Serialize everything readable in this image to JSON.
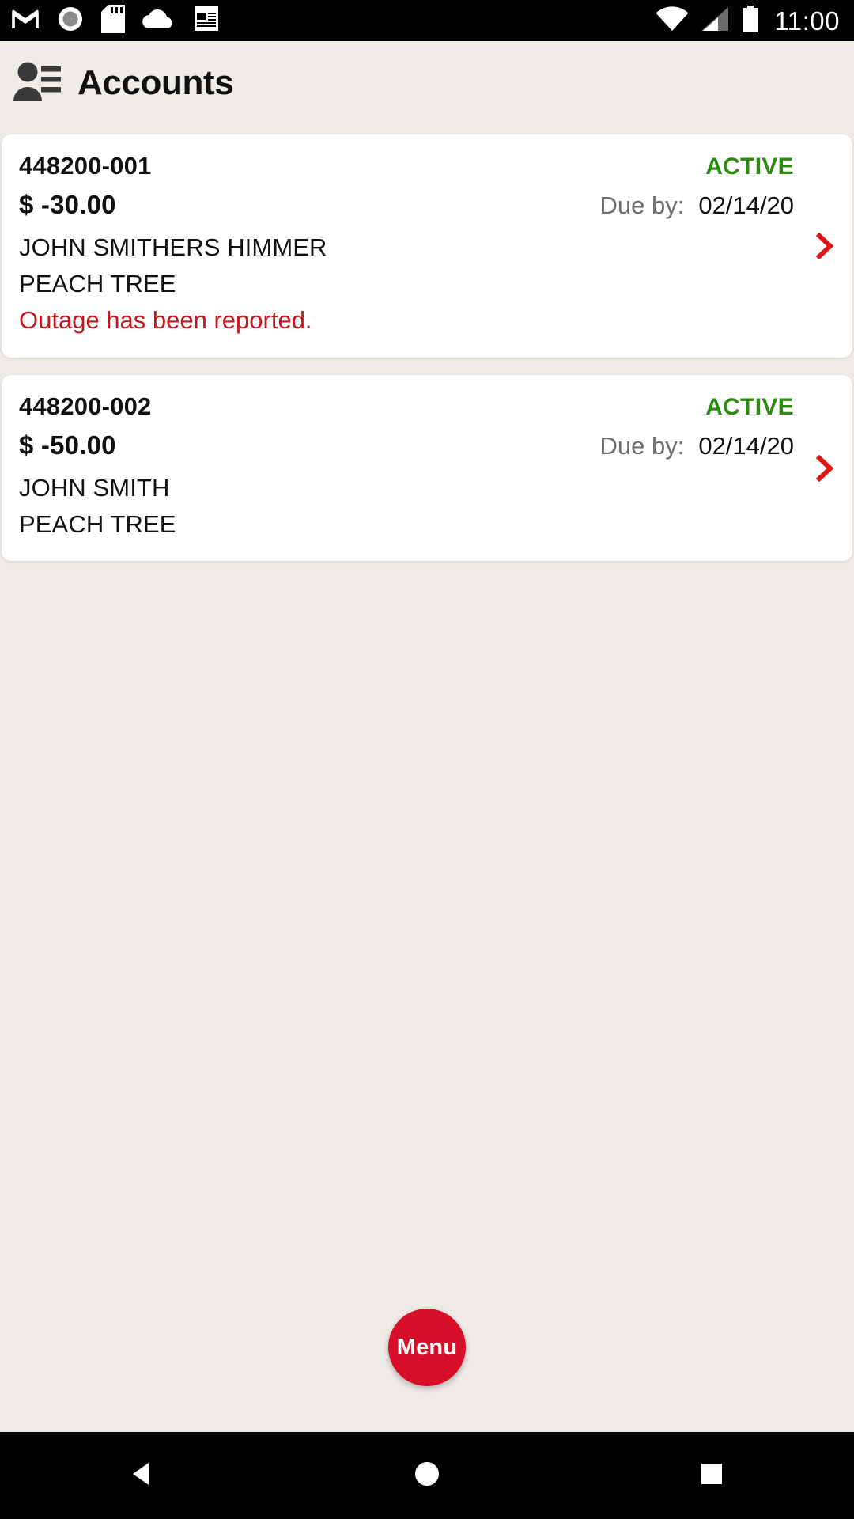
{
  "status_bar": {
    "icons_left": [
      "gmail-icon",
      "record-circle-icon",
      "sd-card-icon",
      "cloud-icon",
      "news-document-icon"
    ],
    "icons_right": [
      "wifi-icon",
      "cellular-signal-icon",
      "battery-icon"
    ],
    "time": "11:00"
  },
  "header": {
    "icon": "contacts-person-list-icon",
    "title": "Accounts"
  },
  "colors": {
    "background": "#efebe7",
    "card": "#ffffff",
    "active_green": "#2e8b13",
    "alert_red": "#c2171c",
    "chevron_red": "#e01616",
    "fab_red": "#d80f28",
    "muted_gray": "#6e6e6e"
  },
  "labels": {
    "due_by": "Due by:",
    "chevron": "chevron-right-icon"
  },
  "accounts": [
    {
      "account_number": "448200-001",
      "status": "ACTIVE",
      "amount": "$ -30.00",
      "due_date": "02/14/20",
      "customer_name": "JOHN SMITHERS HIMMER",
      "address": "PEACH TREE",
      "alert": "Outage has been reported."
    },
    {
      "account_number": "448200-002",
      "status": "ACTIVE",
      "amount": "$ -50.00",
      "due_date": "02/14/20",
      "customer_name": "JOHN SMITH",
      "address": "PEACH TREE",
      "alert": ""
    }
  ],
  "fab": {
    "label": "Menu"
  },
  "nav_bar": {
    "back": "back-triangle-icon",
    "home": "home-circle-icon",
    "recents": "recents-square-icon"
  }
}
